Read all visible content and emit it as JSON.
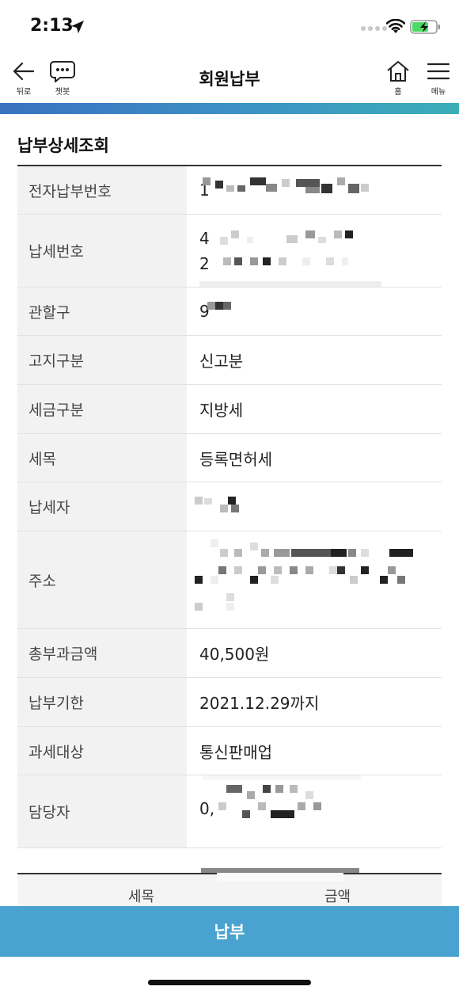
{
  "status": {
    "time": "2:13"
  },
  "header": {
    "title": "회원납부",
    "back_label": "뒤로",
    "chatbot_label": "챗봇",
    "home_label": "홈",
    "menu_label": "메뉴"
  },
  "section_title": "납부상세조회",
  "rows": [
    {
      "label": "전자납부번호",
      "value": "1"
    },
    {
      "label": "납세번호",
      "value": "4",
      "value2": "2"
    },
    {
      "label": "관할구",
      "value": "9"
    },
    {
      "label": "고지구분",
      "value": "신고분"
    },
    {
      "label": "세금구분",
      "value": "지방세"
    },
    {
      "label": "세목",
      "value": "등록면허세"
    },
    {
      "label": "납세자",
      "value": ""
    },
    {
      "label": "주소",
      "value": ""
    },
    {
      "label": "총부과금액",
      "value": "40,500원"
    },
    {
      "label": "납부기한",
      "value": "2021.12.29까지"
    },
    {
      "label": "과세대상",
      "value": "통신판매업"
    },
    {
      "label": "담당자",
      "value": "0,",
      "value2": ""
    }
  ],
  "sub_table": {
    "col1": "세목",
    "col2": "금액"
  },
  "pay_button": "납부",
  "colors": {
    "accent": "#4aa2d0",
    "header_bar_start": "#3a72bf",
    "header_bar_end": "#3aaeb7"
  }
}
